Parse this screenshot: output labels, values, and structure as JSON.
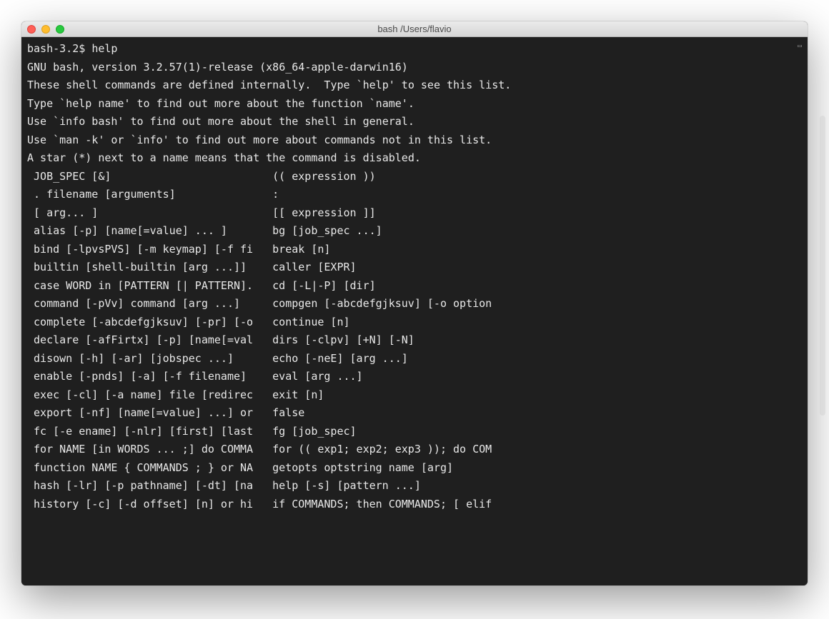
{
  "window": {
    "title": "bash   /Users/flavio"
  },
  "terminal": {
    "prompt": "bash-3.2$ ",
    "command": "help",
    "header": [
      "GNU bash, version 3.2.57(1)-release (x86_64-apple-darwin16)",
      "These shell commands are defined internally.  Type `help' to see this list.",
      "Type `help name' to find out more about the function `name'.",
      "Use `info bash' to find out more about the shell in general.",
      "Use `man -k' or `info' to find out more about commands not in this list.",
      "",
      "A star (*) next to a name means that the command is disabled.",
      ""
    ],
    "columns": [
      {
        "left": " JOB_SPEC [&]",
        "right": "(( expression ))"
      },
      {
        "left": " . filename [arguments]",
        "right": ":"
      },
      {
        "left": " [ arg... ]",
        "right": "[[ expression ]]"
      },
      {
        "left": " alias [-p] [name[=value] ... ]",
        "right": "bg [job_spec ...]"
      },
      {
        "left": " bind [-lpvsPVS] [-m keymap] [-f fi",
        "right": "break [n]"
      },
      {
        "left": " builtin [shell-builtin [arg ...]]",
        "right": "caller [EXPR]"
      },
      {
        "left": " case WORD in [PATTERN [| PATTERN].",
        "right": "cd [-L|-P] [dir]"
      },
      {
        "left": " command [-pVv] command [arg ...]",
        "right": "compgen [-abcdefgjksuv] [-o option"
      },
      {
        "left": " complete [-abcdefgjksuv] [-pr] [-o",
        "right": "continue [n]"
      },
      {
        "left": " declare [-afFirtx] [-p] [name[=val",
        "right": "dirs [-clpv] [+N] [-N]"
      },
      {
        "left": " disown [-h] [-ar] [jobspec ...]",
        "right": "echo [-neE] [arg ...]"
      },
      {
        "left": " enable [-pnds] [-a] [-f filename]",
        "right": "eval [arg ...]"
      },
      {
        "left": " exec [-cl] [-a name] file [redirec",
        "right": "exit [n]"
      },
      {
        "left": " export [-nf] [name[=value] ...] or",
        "right": "false"
      },
      {
        "left": " fc [-e ename] [-nlr] [first] [last",
        "right": "fg [job_spec]"
      },
      {
        "left": " for NAME [in WORDS ... ;] do COMMA",
        "right": "for (( exp1; exp2; exp3 )); do COM"
      },
      {
        "left": " function NAME { COMMANDS ; } or NA",
        "right": "getopts optstring name [arg]"
      },
      {
        "left": " hash [-lr] [-p pathname] [-dt] [na",
        "right": "help [-s] [pattern ...]"
      },
      {
        "left": " history [-c] [-d offset] [n] or hi",
        "right": "if COMMANDS; then COMMANDS; [ elif"
      }
    ]
  }
}
